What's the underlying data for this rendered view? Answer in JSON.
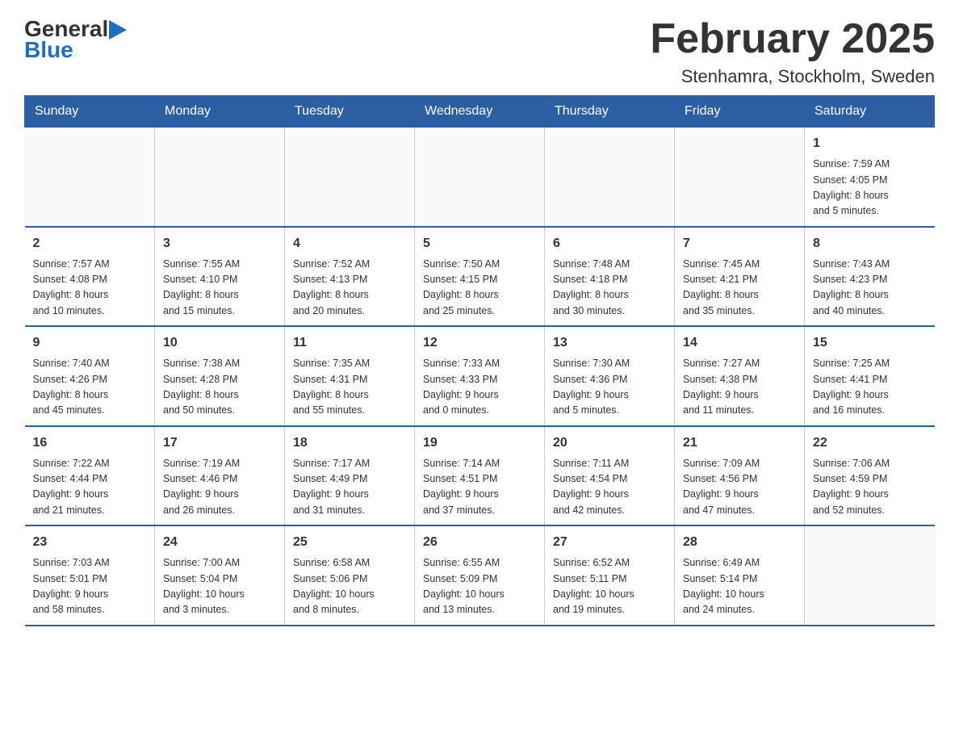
{
  "header": {
    "logo_general": "General",
    "logo_blue": "Blue",
    "title": "February 2025",
    "subtitle": "Stenhamra, Stockholm, Sweden"
  },
  "days_of_week": [
    "Sunday",
    "Monday",
    "Tuesday",
    "Wednesday",
    "Thursday",
    "Friday",
    "Saturday"
  ],
  "weeks": [
    {
      "days": [
        {
          "number": "",
          "info": ""
        },
        {
          "number": "",
          "info": ""
        },
        {
          "number": "",
          "info": ""
        },
        {
          "number": "",
          "info": ""
        },
        {
          "number": "",
          "info": ""
        },
        {
          "number": "",
          "info": ""
        },
        {
          "number": "1",
          "info": "Sunrise: 7:59 AM\nSunset: 4:05 PM\nDaylight: 8 hours\nand 5 minutes."
        }
      ]
    },
    {
      "days": [
        {
          "number": "2",
          "info": "Sunrise: 7:57 AM\nSunset: 4:08 PM\nDaylight: 8 hours\nand 10 minutes."
        },
        {
          "number": "3",
          "info": "Sunrise: 7:55 AM\nSunset: 4:10 PM\nDaylight: 8 hours\nand 15 minutes."
        },
        {
          "number": "4",
          "info": "Sunrise: 7:52 AM\nSunset: 4:13 PM\nDaylight: 8 hours\nand 20 minutes."
        },
        {
          "number": "5",
          "info": "Sunrise: 7:50 AM\nSunset: 4:15 PM\nDaylight: 8 hours\nand 25 minutes."
        },
        {
          "number": "6",
          "info": "Sunrise: 7:48 AM\nSunset: 4:18 PM\nDaylight: 8 hours\nand 30 minutes."
        },
        {
          "number": "7",
          "info": "Sunrise: 7:45 AM\nSunset: 4:21 PM\nDaylight: 8 hours\nand 35 minutes."
        },
        {
          "number": "8",
          "info": "Sunrise: 7:43 AM\nSunset: 4:23 PM\nDaylight: 8 hours\nand 40 minutes."
        }
      ]
    },
    {
      "days": [
        {
          "number": "9",
          "info": "Sunrise: 7:40 AM\nSunset: 4:26 PM\nDaylight: 8 hours\nand 45 minutes."
        },
        {
          "number": "10",
          "info": "Sunrise: 7:38 AM\nSunset: 4:28 PM\nDaylight: 8 hours\nand 50 minutes."
        },
        {
          "number": "11",
          "info": "Sunrise: 7:35 AM\nSunset: 4:31 PM\nDaylight: 8 hours\nand 55 minutes."
        },
        {
          "number": "12",
          "info": "Sunrise: 7:33 AM\nSunset: 4:33 PM\nDaylight: 9 hours\nand 0 minutes."
        },
        {
          "number": "13",
          "info": "Sunrise: 7:30 AM\nSunset: 4:36 PM\nDaylight: 9 hours\nand 5 minutes."
        },
        {
          "number": "14",
          "info": "Sunrise: 7:27 AM\nSunset: 4:38 PM\nDaylight: 9 hours\nand 11 minutes."
        },
        {
          "number": "15",
          "info": "Sunrise: 7:25 AM\nSunset: 4:41 PM\nDaylight: 9 hours\nand 16 minutes."
        }
      ]
    },
    {
      "days": [
        {
          "number": "16",
          "info": "Sunrise: 7:22 AM\nSunset: 4:44 PM\nDaylight: 9 hours\nand 21 minutes."
        },
        {
          "number": "17",
          "info": "Sunrise: 7:19 AM\nSunset: 4:46 PM\nDaylight: 9 hours\nand 26 minutes."
        },
        {
          "number": "18",
          "info": "Sunrise: 7:17 AM\nSunset: 4:49 PM\nDaylight: 9 hours\nand 31 minutes."
        },
        {
          "number": "19",
          "info": "Sunrise: 7:14 AM\nSunset: 4:51 PM\nDaylight: 9 hours\nand 37 minutes."
        },
        {
          "number": "20",
          "info": "Sunrise: 7:11 AM\nSunset: 4:54 PM\nDaylight: 9 hours\nand 42 minutes."
        },
        {
          "number": "21",
          "info": "Sunrise: 7:09 AM\nSunset: 4:56 PM\nDaylight: 9 hours\nand 47 minutes."
        },
        {
          "number": "22",
          "info": "Sunrise: 7:06 AM\nSunset: 4:59 PM\nDaylight: 9 hours\nand 52 minutes."
        }
      ]
    },
    {
      "days": [
        {
          "number": "23",
          "info": "Sunrise: 7:03 AM\nSunset: 5:01 PM\nDaylight: 9 hours\nand 58 minutes."
        },
        {
          "number": "24",
          "info": "Sunrise: 7:00 AM\nSunset: 5:04 PM\nDaylight: 10 hours\nand 3 minutes."
        },
        {
          "number": "25",
          "info": "Sunrise: 6:58 AM\nSunset: 5:06 PM\nDaylight: 10 hours\nand 8 minutes."
        },
        {
          "number": "26",
          "info": "Sunrise: 6:55 AM\nSunset: 5:09 PM\nDaylight: 10 hours\nand 13 minutes."
        },
        {
          "number": "27",
          "info": "Sunrise: 6:52 AM\nSunset: 5:11 PM\nDaylight: 10 hours\nand 19 minutes."
        },
        {
          "number": "28",
          "info": "Sunrise: 6:49 AM\nSunset: 5:14 PM\nDaylight: 10 hours\nand 24 minutes."
        },
        {
          "number": "",
          "info": ""
        }
      ]
    }
  ]
}
